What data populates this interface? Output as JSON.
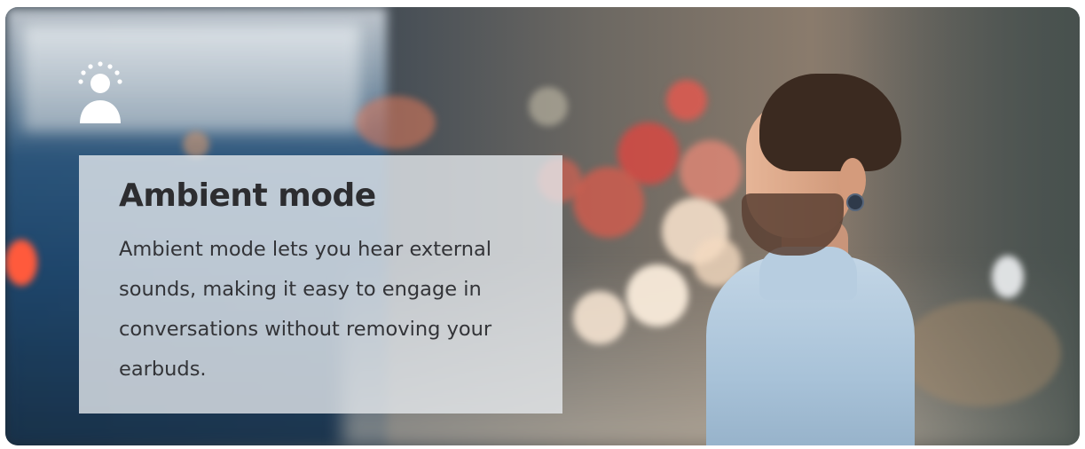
{
  "banner": {
    "title": "Ambient mode",
    "description": "Ambient mode lets you hear external sounds, making it easy to engage in conversations without removing your earbuds.",
    "icon": "ambient-mode-icon",
    "colors": {
      "title": "#2d2d30",
      "text": "#333438",
      "card_background": "#e8ecf0"
    }
  }
}
